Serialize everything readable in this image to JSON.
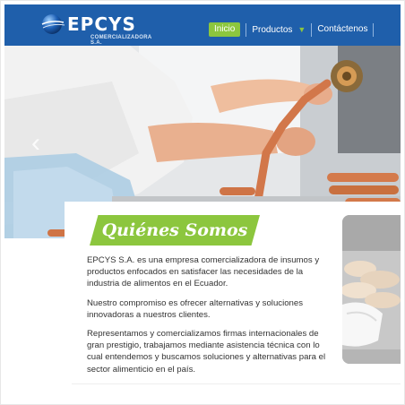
{
  "header": {
    "brand": "EPCYS",
    "brand_sub": "COMERCIALIZADORA S.A.",
    "nav": [
      {
        "label": "Inicio",
        "active": true
      },
      {
        "label": "Productos",
        "active": false
      },
      {
        "label": "Contáctenos",
        "active": false
      }
    ],
    "colors": {
      "bar": "#1f5fab",
      "accent": "#8cc63e"
    }
  },
  "hero": {
    "image": "sausage-production-photo",
    "arrow_icon": "chevron-left-icon"
  },
  "about": {
    "title": "Quiénes Somos",
    "paragraphs": [
      "EPCYS S.A. es una empresa comercializadora de insumos y productos enfocados en satisfacer las necesidades de la industria de alimentos en el Ecuador.",
      "Nuestro compromiso es ofrecer alternativas y soluciones innovadoras a nuestros clientes.",
      "Representamos y comercializamos firmas internacionales de gran prestigio, trabajamos mediante asistencia técnica con lo cual entendemos y buscamos soluciones y alternativas para el sector alimenticio en el país."
    ],
    "side_image": "sausage-casing-photo"
  }
}
